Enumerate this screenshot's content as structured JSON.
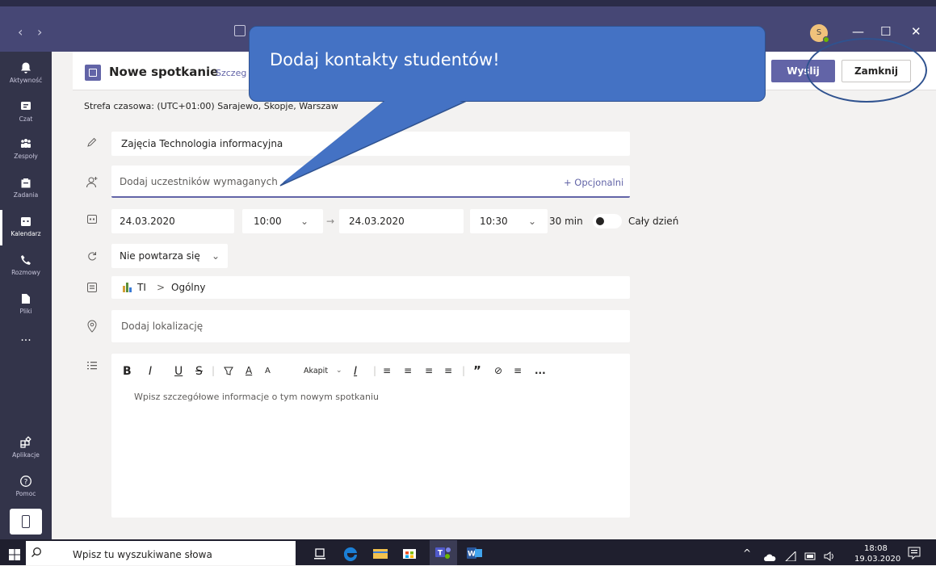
{
  "titlebar": {
    "back": "‹",
    "forward": "›",
    "minimize": "—",
    "maximize": "☐",
    "close": "✕",
    "avatar_initial": "S"
  },
  "rail": {
    "items": [
      {
        "label": "Aktywność",
        "icon": "bell-icon"
      },
      {
        "label": "Czat",
        "icon": "chat-icon"
      },
      {
        "label": "Zespoły",
        "icon": "teams-icon"
      },
      {
        "label": "Zadania",
        "icon": "assignments-icon"
      },
      {
        "label": "Kalendarz",
        "icon": "calendar-icon"
      },
      {
        "label": "Rozmowy",
        "icon": "phone-icon"
      },
      {
        "label": "Pliki",
        "icon": "file-icon"
      },
      {
        "label": "...",
        "icon": "more-icon"
      },
      {
        "label": "Aplikacje",
        "icon": "apps-icon"
      },
      {
        "label": "Pomoc",
        "icon": "help-icon"
      }
    ]
  },
  "header": {
    "title": "Nowe spotkanie",
    "tab": "Szczeg",
    "send": "Wyślij",
    "close": "Zamknij"
  },
  "timezone": "Strefa czasowa: (UTC+01:00) Sarajewo, Skopje, Warszaw",
  "form": {
    "title_value": "Zajęcia Technologia informacyjna",
    "attendees_placeholder": "Dodaj uczestników wymaganych",
    "optional": "+ Opcjonalni",
    "start_date": "24.03.2020",
    "start_time": "10:00",
    "arrow": "→",
    "end_date": "24.03.2020",
    "end_time": "10:30",
    "duration": "30 min",
    "all_day": "Cały dzień",
    "repeat": "Nie powtarza się",
    "channel_team": "TI",
    "channel_sep": ">",
    "channel_name": "Ogólny",
    "location_placeholder": "Dodaj lokalizację",
    "editor_placeholder": "Wpisz szczegółowe informacje o tym nowym spotkaniu",
    "toolbar": [
      "B",
      "I",
      "U",
      "S",
      "|",
      "A",
      "A",
      "Akapit",
      "I",
      "|",
      "≡",
      "≡",
      "≡",
      "≡",
      "|",
      "”",
      "⊘",
      "≡",
      "..."
    ]
  },
  "callout": {
    "text": "Dodaj kontakty studentów!"
  },
  "taskbar": {
    "search_placeholder": "Wpisz tu wyszukiwane słowa",
    "time": "18:08",
    "date": "19.03.2020"
  },
  "colors": {
    "teams_purple": "#464775",
    "rail": "#33344a",
    "accent": "#6264a7",
    "callout": "#4472c4",
    "annotation": "#2f528f"
  }
}
